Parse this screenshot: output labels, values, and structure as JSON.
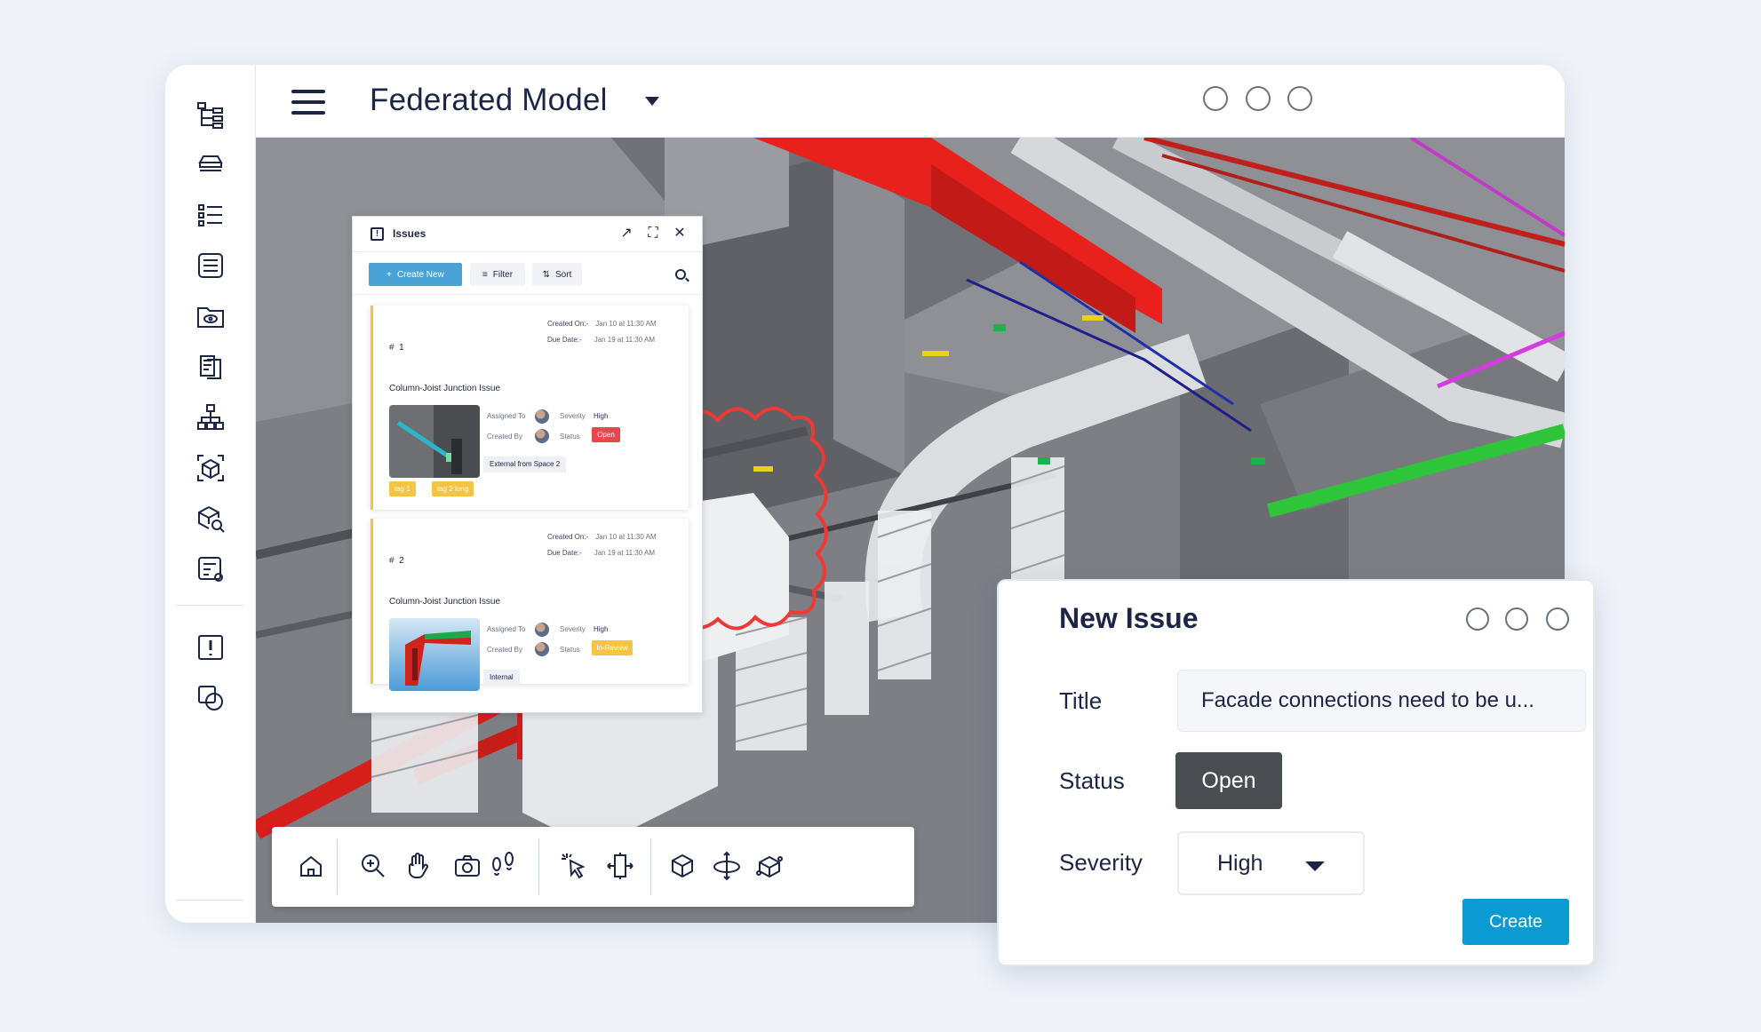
{
  "topbar": {
    "title": "Federated Model"
  },
  "rail": {
    "icons": [
      "model-tree-icon",
      "layers-icon",
      "list-icon",
      "properties-icon",
      "folder-view-icon",
      "documents-icon",
      "hierarchy-icon",
      "3d-box-icon",
      "box-search-icon",
      "settings-form-icon",
      "issues-icon",
      "compare-icon"
    ]
  },
  "issues_panel": {
    "title": "Issues",
    "create_label": "Create New",
    "filter_label": "Filter",
    "sort_label": "Sort",
    "cards": [
      {
        "number": "1",
        "created_on_label": "Created On:-",
        "created_on": "Jan 10 at 11:30 AM",
        "due_date_label": "Due Date:-",
        "due_date": "Jan 19 at 11:30 AM",
        "title": "Column-Joist Junction Issue",
        "assigned_label": "Assigned To",
        "created_by_label": "Created By",
        "severity_label": "Severity",
        "severity": "High",
        "status_label": "Status",
        "status": "Open",
        "status_color": "#e5484d",
        "chip": "External from Space 2",
        "tags": [
          "tag 1",
          "tag 2 long"
        ]
      },
      {
        "number": "2",
        "created_on_label": "Created On:-",
        "created_on": "Jan 10 at 11:30 AM",
        "due_date_label": "Due Date:-",
        "due_date": "Jan 19 at 11:30 AM",
        "title": "Column-Joist Junction Issue",
        "assigned_label": "Assigned To",
        "created_by_label": "Created By",
        "severity_label": "Severity",
        "severity": "High",
        "status_label": "Status",
        "status": "In-Review",
        "status_color": "#f6c343",
        "chip": "Internal"
      }
    ]
  },
  "toolbar": {
    "icons": [
      "home-icon",
      "zoom-in-icon",
      "pan-hand-icon",
      "camera-icon",
      "walk-footsteps-icon",
      "select-pointer-icon",
      "section-plane-icon",
      "cube-view-icon",
      "orbit-icon",
      "iso-cube-icon"
    ]
  },
  "dialog": {
    "title": "New Issue",
    "title_label": "Title",
    "title_value": "Facade connections need to be u...",
    "status_label": "Status",
    "status_value": "Open",
    "severity_label": "Severity",
    "severity_value": "High",
    "create_label": "Create"
  },
  "colors": {
    "accent": "#0a9bd3",
    "open": "#e5484d",
    "in_review": "#f6c343",
    "markup": "#ee3a34"
  }
}
